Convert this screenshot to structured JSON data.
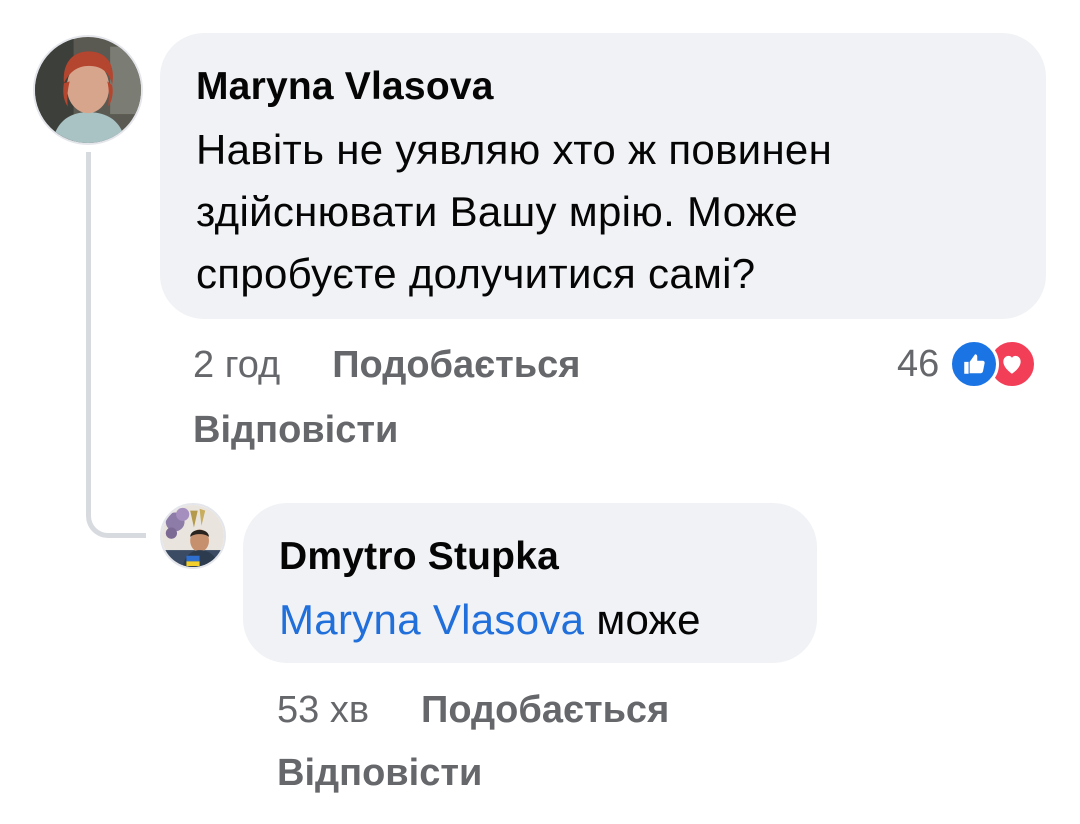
{
  "comment": {
    "author": "Maryna Vlasova",
    "lines": [
      "Навіть не уявляю хто ж повинен",
      "здійснювати Вашу мрію. Може",
      "спробуєте долучитися самі?"
    ],
    "time": "2 год",
    "like_label": "Подобається",
    "reply_label": "Відповісти",
    "reactions": {
      "count": "46",
      "icons": [
        "like-icon",
        "love-icon"
      ]
    }
  },
  "reply": {
    "author": "Dmytro Stupka",
    "mention": "Maryna Vlasova",
    "text": " може",
    "time": "53 хв",
    "like_label": "Подобається",
    "reply_label": "Відповісти"
  },
  "colors": {
    "bubble_background": "#f0f2f5",
    "mention": "#216fdb",
    "meta_text": "#65676b",
    "like_reaction": "#1b74e4",
    "love_reaction": "#f33e58"
  }
}
